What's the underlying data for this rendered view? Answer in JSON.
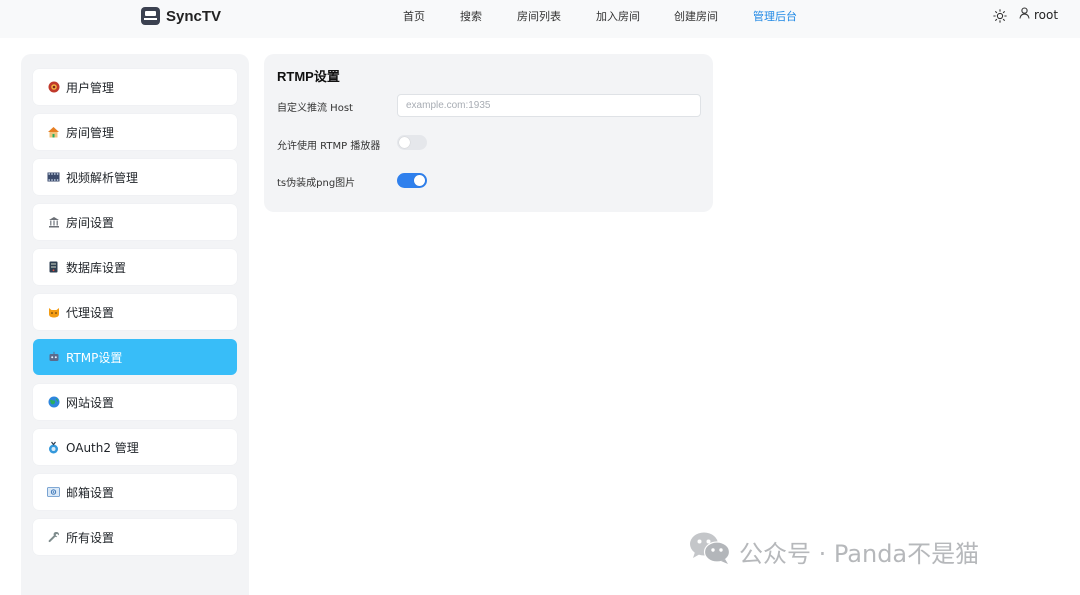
{
  "header": {
    "brand": "SyncTV",
    "nav": [
      {
        "label": "首页",
        "active": false
      },
      {
        "label": "搜索",
        "active": false
      },
      {
        "label": "房间列表",
        "active": false
      },
      {
        "label": "加入房间",
        "active": false
      },
      {
        "label": "创建房间",
        "active": false
      },
      {
        "label": "管理后台",
        "active": true
      }
    ],
    "theme_icon": "sun-icon",
    "user": {
      "icon": "user-icon",
      "name": "root"
    }
  },
  "sidebar": {
    "items": [
      {
        "icon": "user-management-icon",
        "label": "用户管理",
        "active": false
      },
      {
        "icon": "house-icon",
        "label": "房间管理",
        "active": false
      },
      {
        "icon": "film-icon",
        "label": "视频解析管理",
        "active": false
      },
      {
        "icon": "bank-icon",
        "label": "房间设置",
        "active": false
      },
      {
        "icon": "database-icon",
        "label": "数据库设置",
        "active": false
      },
      {
        "icon": "cat-icon",
        "label": "代理设置",
        "active": false
      },
      {
        "icon": "robot-icon",
        "label": "RTMP设置",
        "active": true
      },
      {
        "icon": "globe-icon",
        "label": "网站设置",
        "active": false
      },
      {
        "icon": "oauth-icon",
        "label": "OAuth2 管理",
        "active": false
      },
      {
        "icon": "mail-icon",
        "label": "邮箱设置",
        "active": false
      },
      {
        "icon": "wrench-icon",
        "label": "所有设置",
        "active": false
      }
    ]
  },
  "panel": {
    "title": "RTMP设置",
    "host_field": {
      "label": "自定义推流 Host",
      "value": "",
      "placeholder": "example.com:1935"
    },
    "rtmp_player_toggle": {
      "label": "允许使用 RTMP 播放器",
      "enabled": false
    },
    "ts_png_toggle": {
      "label": "ts伪装成png图片",
      "enabled": true
    }
  },
  "watermark": {
    "icon": "wechat-icon",
    "text": "公众号 · Panda不是猫"
  },
  "colors": {
    "accent": "#38bdf8",
    "nav_active": "#1e88e5",
    "toggle_on": "#2f80ed",
    "panel_bg": "#f3f4f6"
  }
}
